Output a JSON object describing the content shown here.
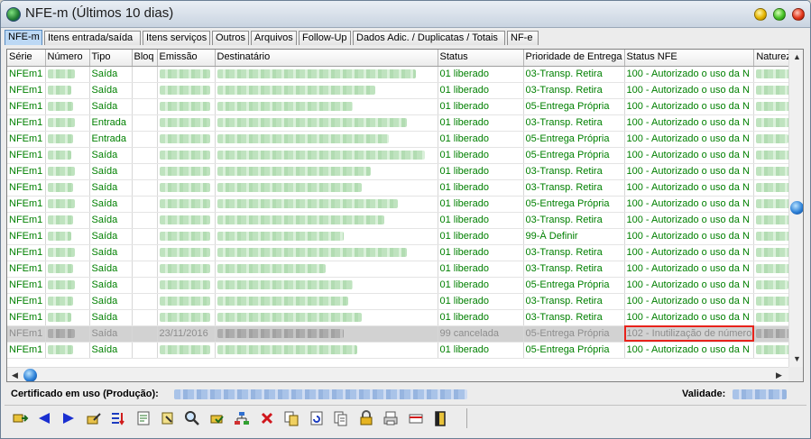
{
  "window": {
    "title": "NFE-m (Últimos 10 dias)"
  },
  "tabs": [
    {
      "label": "NFE-m",
      "active": true
    },
    {
      "label": "Itens entrada/saída",
      "active": false
    },
    {
      "label": "Itens serviços",
      "active": false
    },
    {
      "label": "Outros",
      "active": false
    },
    {
      "label": "Arquivos",
      "active": false
    },
    {
      "label": "Follow-Up",
      "active": false
    },
    {
      "label": "Dados Adic. / Duplicatas / Totais",
      "active": false
    },
    {
      "label": "NF-e",
      "active": false
    }
  ],
  "grid": {
    "columns": [
      "Série",
      "Número",
      "Tipo",
      "Bloq",
      "Emissão",
      "Destinatário",
      "Status",
      "Prioridade de Entrega",
      "Status NFE",
      "Natureza"
    ],
    "rows": [
      {
        "serie": "NFEm1",
        "tipo": "Saída",
        "emissao": "",
        "status": "01 liberado",
        "prioridade": "03-Transp. Retira",
        "status_nfe": "100 - Autorizado o uso da N"
      },
      {
        "serie": "NFEm1",
        "tipo": "Saída",
        "emissao": "",
        "status": "01 liberado",
        "prioridade": "03-Transp. Retira",
        "status_nfe": "100 - Autorizado o uso da N"
      },
      {
        "serie": "NFEm1",
        "tipo": "Saída",
        "emissao": "",
        "status": "01 liberado",
        "prioridade": "05-Entrega Própria",
        "status_nfe": "100 - Autorizado o uso da N"
      },
      {
        "serie": "NFEm1",
        "tipo": "Entrada",
        "emissao": "",
        "status": "01 liberado",
        "prioridade": "03-Transp. Retira",
        "status_nfe": "100 - Autorizado o uso da N"
      },
      {
        "serie": "NFEm1",
        "tipo": "Entrada",
        "emissao": "",
        "status": "01 liberado",
        "prioridade": "05-Entrega Própria",
        "status_nfe": "100 - Autorizado o uso da N"
      },
      {
        "serie": "NFEm1",
        "tipo": "Saída",
        "emissao": "",
        "status": "01 liberado",
        "prioridade": "05-Entrega Própria",
        "status_nfe": "100 - Autorizado o uso da N"
      },
      {
        "serie": "NFEm1",
        "tipo": "Saída",
        "emissao": "",
        "status": "01 liberado",
        "prioridade": "03-Transp. Retira",
        "status_nfe": "100 - Autorizado o uso da N"
      },
      {
        "serie": "NFEm1",
        "tipo": "Saída",
        "emissao": "",
        "status": "01 liberado",
        "prioridade": "03-Transp. Retira",
        "status_nfe": "100 - Autorizado o uso da N"
      },
      {
        "serie": "NFEm1",
        "tipo": "Saída",
        "emissao": "",
        "status": "01 liberado",
        "prioridade": "05-Entrega Própria",
        "status_nfe": "100 - Autorizado o uso da N"
      },
      {
        "serie": "NFEm1",
        "tipo": "Saída",
        "emissao": "",
        "status": "01 liberado",
        "prioridade": "03-Transp. Retira",
        "status_nfe": "100 - Autorizado o uso da N"
      },
      {
        "serie": "NFEm1",
        "tipo": "Saída",
        "emissao": "",
        "status": "01 liberado",
        "prioridade": "99-À Definir",
        "status_nfe": "100 - Autorizado o uso da N"
      },
      {
        "serie": "NFEm1",
        "tipo": "Saída",
        "emissao": "",
        "status": "01 liberado",
        "prioridade": "03-Transp. Retira",
        "status_nfe": "100 - Autorizado o uso da N"
      },
      {
        "serie": "NFEm1",
        "tipo": "Saída",
        "emissao": "",
        "status": "01 liberado",
        "prioridade": "03-Transp. Retira",
        "status_nfe": "100 - Autorizado o uso da N"
      },
      {
        "serie": "NFEm1",
        "tipo": "Saída",
        "emissao": "",
        "status": "01 liberado",
        "prioridade": "05-Entrega Própria",
        "status_nfe": "100 - Autorizado o uso da N"
      },
      {
        "serie": "NFEm1",
        "tipo": "Saída",
        "emissao": "",
        "status": "01 liberado",
        "prioridade": "03-Transp. Retira",
        "status_nfe": "100 - Autorizado o uso da N"
      },
      {
        "serie": "NFEm1",
        "tipo": "Saída",
        "emissao": "",
        "status": "01 liberado",
        "prioridade": "03-Transp. Retira",
        "status_nfe": "100 - Autorizado o uso da N"
      },
      {
        "serie": "NFEm1",
        "tipo": "Saída",
        "emissao": "23/11/2016",
        "status": "99 cancelada",
        "prioridade": "05-Entrega Própria",
        "status_nfe": "102 - Inutilização de número",
        "cancelled": true,
        "highlight": true
      },
      {
        "serie": "NFEm1",
        "tipo": "Saída",
        "emissao": "",
        "status": "01 liberado",
        "prioridade": "05-Entrega Própria",
        "status_nfe": "100 - Autorizado o uso da N"
      }
    ]
  },
  "footer": {
    "cert_label": "Certificado em uso (Produção):",
    "validade_label": "Validade:"
  },
  "toolbar": {
    "icons": [
      "exit-icon",
      "previous-icon",
      "next-icon",
      "edit-icon",
      "filter-icon",
      "export-icon",
      "tools-icon",
      "search-icon",
      "print-preview-icon",
      "network-icon",
      "delete-icon",
      "copy-icon",
      "refresh-icon",
      "documents-icon",
      "lock-icon",
      "printer-icon",
      "card-icon",
      "door-icon"
    ]
  },
  "colors": {
    "row_text": "#008000",
    "cancelled_row_bg": "#d2d2d2",
    "highlight_outline": "#e8221b",
    "active_tab_bg": "#bcd8f4"
  }
}
